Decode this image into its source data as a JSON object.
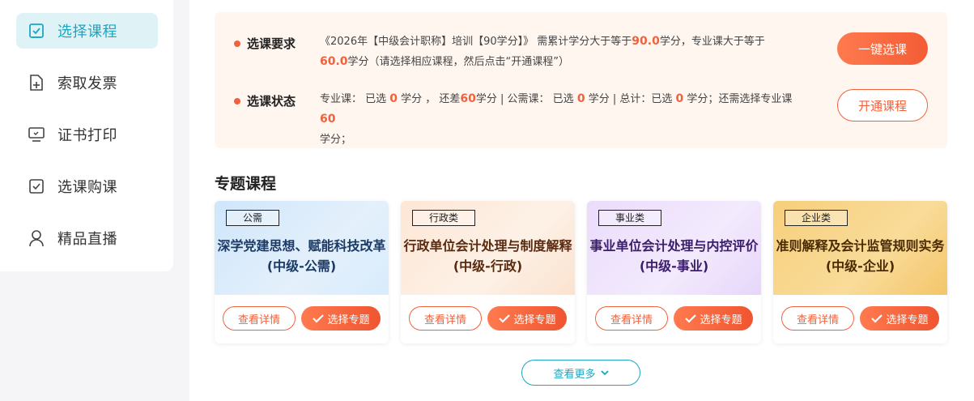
{
  "sidebar": {
    "items": [
      {
        "label": "选择课程",
        "icon": "checkbox-icon",
        "active": true
      },
      {
        "label": "索取发票",
        "icon": "document-add-icon",
        "active": false
      },
      {
        "label": "证书打印",
        "icon": "monitor-icon",
        "active": false
      },
      {
        "label": "选课购课",
        "icon": "checkbox-icon",
        "active": false
      },
      {
        "label": "精品直播",
        "icon": "user-icon",
        "active": false
      }
    ]
  },
  "requirement": {
    "title": "选课要求",
    "pre": "《2026年【中级会计职称】培训【90学分】》 需累计学分大于等于",
    "total": "90.0",
    "mid": "学分，专业课大于等于",
    "major": "60.0",
    "post": "学分（请选择相应课程，然后点击“开通课程”）"
  },
  "status": {
    "title": "选课状态",
    "p1": "专业课：  已选 ",
    "major_selected": "0",
    "p2": " 学分 ，  还差",
    "major_missing": "60",
    "p3": "学分 | 公需课：  已选 ",
    "public_selected": "0",
    "p4": " 学分 | 总计：已选 ",
    "total_selected": "0",
    "p5": " 学分；还需选择专业课",
    "need_major": "60",
    "p6": "学分；"
  },
  "buttons": {
    "one_click": "一键选课",
    "open_course": "开通课程"
  },
  "section_title": "专题课程",
  "cards": [
    {
      "tag": "公需",
      "line1": "深学党建思想、赋能科技改革",
      "line2": "(中级-公需)"
    },
    {
      "tag": "行政类",
      "line1": "行政单位会计处理与制度解释",
      "line2": "(中级-行政)"
    },
    {
      "tag": "事业类",
      "line1": "事业单位会计处理与内控评价",
      "line2": "(中级-事业)"
    },
    {
      "tag": "企业类",
      "line1": "准则解释及会计监管规则实务",
      "line2": "(中级-企业)"
    }
  ],
  "card_actions": {
    "detail": "查看详情",
    "select": "选择专题"
  },
  "more_label": "查看更多",
  "colors": {
    "accent": "#f0623c",
    "teal": "#1aa6c4"
  }
}
